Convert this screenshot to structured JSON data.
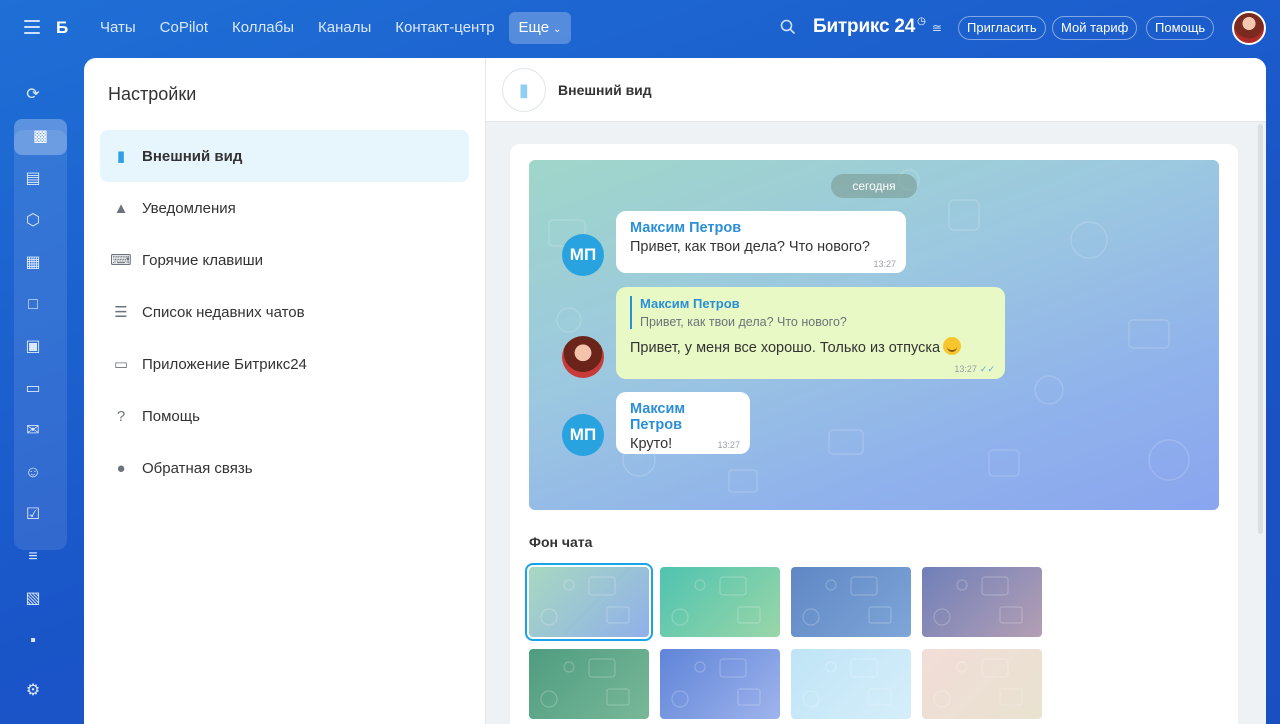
{
  "topbar": {
    "brand_letter": "Б",
    "nav": [
      "Чаты",
      "CoPilot",
      "Коллабы",
      "Каналы",
      "Контакт-центр"
    ],
    "more_label": "Еще",
    "logo": "Битрикс 24",
    "buttons": {
      "invite": "Пригласить",
      "tariff": "Мой тариф",
      "help": "Помощь"
    }
  },
  "rail_icons": [
    "bot-icon",
    "chat-icon",
    "feed-icon",
    "hexagon-icon",
    "calendar-icon",
    "document-icon",
    "board-icon",
    "card-icon",
    "mail-icon",
    "people-icon",
    "tasks-icon",
    "filter-icon",
    "planner-icon",
    "store-icon",
    "settings-icon"
  ],
  "settings": {
    "title": "Настройки",
    "items": [
      {
        "label": "Внешний вид",
        "icon": "brush-icon"
      },
      {
        "label": "Уведомления",
        "icon": "bell-icon"
      },
      {
        "label": "Горячие клавиши",
        "icon": "keyboard-icon"
      },
      {
        "label": "Список недавних чатов",
        "icon": "list-icon"
      },
      {
        "label": "Приложение Битрикс24",
        "icon": "monitor-icon"
      },
      {
        "label": "Помощь",
        "icon": "question-icon"
      },
      {
        "label": "Обратная связь",
        "icon": "speech-bubble-icon"
      }
    ]
  },
  "content": {
    "header_title": "Внешний вид",
    "preview": {
      "date_label": "сегодня",
      "messages": [
        {
          "author": "Максим Петров",
          "initials": "МП",
          "text": "Привет, как твои дела? Что нового?",
          "time": "13:27"
        },
        {
          "quote_author": "Максим Петров",
          "quote_text": "Привет, как твои дела? Что нового?",
          "text": "Привет, у меня все хорошо. Только из отпуска",
          "time": "13:27"
        },
        {
          "author": "Максим Петров",
          "initials": "МП",
          "text": "Круто!",
          "time": "13:27"
        }
      ]
    },
    "background_title": "Фон чата",
    "swatch_colors": [
      [
        "#a8d8c0",
        "#8fb0ea"
      ],
      [
        "#4fc3b0",
        "#9ad6a8"
      ],
      [
        "#5f87c4",
        "#7fa6d8"
      ],
      [
        "#6f7fb8",
        "#b49fb4"
      ],
      [
        "#4f9c80",
        "#78b898"
      ],
      [
        "#5f84d8",
        "#9fb4ec"
      ],
      [
        "#bfe4f6",
        "#d6eefa"
      ],
      [
        "#f2ddd8",
        "#e8e2d0"
      ]
    ]
  },
  "colors": {
    "accent": "#2ea0e3",
    "active_bg": "#e6f6fc",
    "link": "#2b8fd8"
  }
}
